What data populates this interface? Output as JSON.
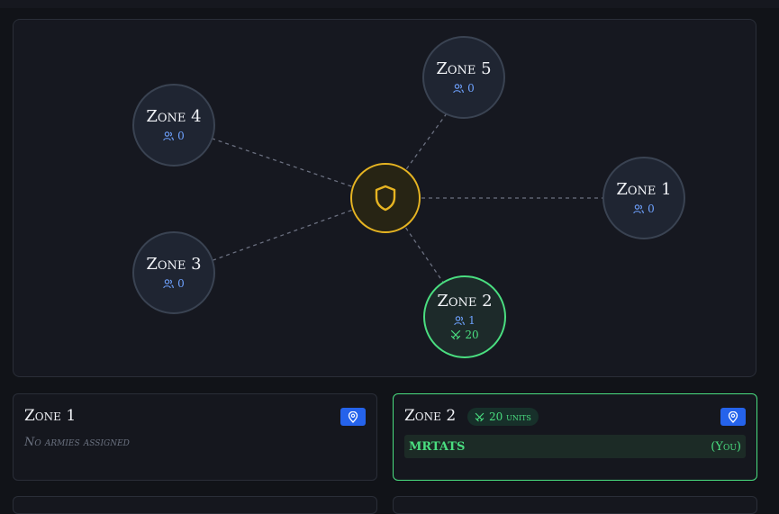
{
  "zones": [
    {
      "id": "zone-4",
      "name": "Zone 4",
      "armies": "0"
    },
    {
      "id": "zone-5",
      "name": "Zone 5",
      "armies": "0"
    },
    {
      "id": "zone-1",
      "name": "Zone 1",
      "armies": "0"
    },
    {
      "id": "zone-3",
      "name": "Zone 3",
      "armies": "0"
    },
    {
      "id": "zone-2",
      "name": "Zone 2",
      "armies": "1",
      "units": "20"
    }
  ],
  "hub": {
    "icon": "shield-icon",
    "color": "#e6b422"
  },
  "cards": {
    "zone1": {
      "title": "Zone 1",
      "empty": "No armies assigned"
    },
    "zone2": {
      "title": "Zone 2",
      "units_badge": "20 units",
      "army_name": "MRTATS",
      "army_tag": "(You)"
    }
  },
  "colors": {
    "accent_blue": "#2563eb",
    "active_green": "#4ade80",
    "hub_gold": "#e6b422"
  }
}
